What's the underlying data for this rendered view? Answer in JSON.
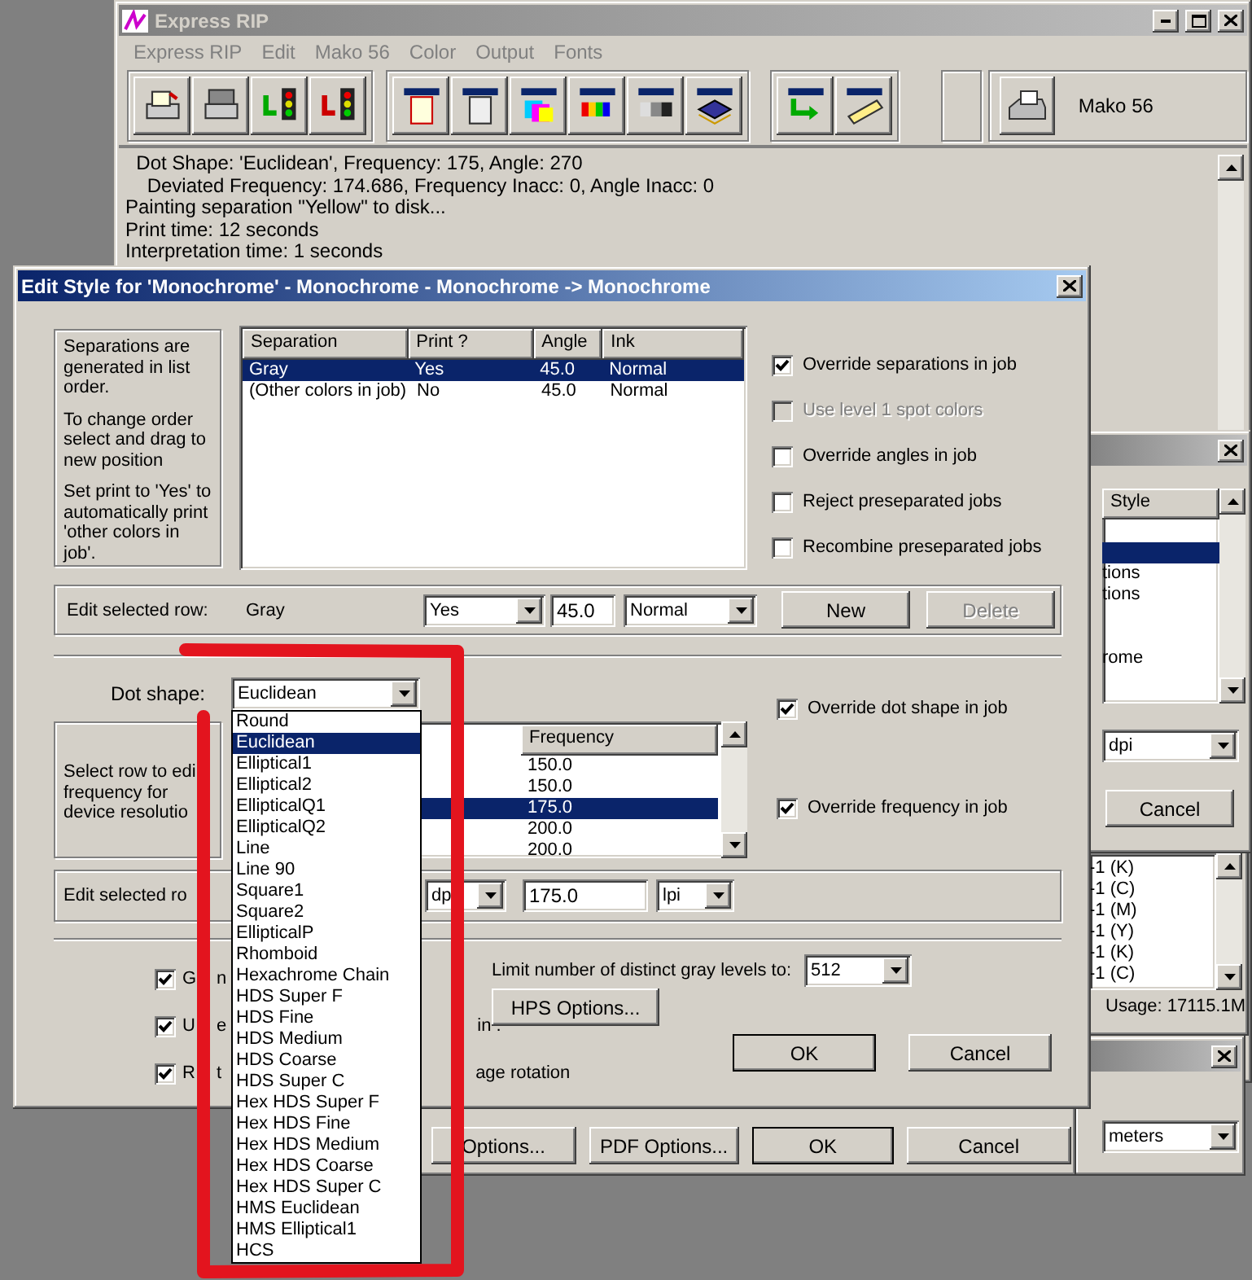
{
  "main_window": {
    "title": "Express RIP",
    "menu": [
      "Express RIP",
      "Edit",
      "Mako 56",
      "Color",
      "Output",
      "Fonts"
    ],
    "device": "Mako 56",
    "log": [
      "  Dot Shape: 'Euclidean', Frequency: 175, Angle: 270",
      "    Deviated Frequency: 174.686, Frequency Inacc: 0, Angle Inacc: 0",
      "Painting separation \"Yellow\" to disk...",
      "Print time: 12 seconds",
      "Interpretation time: 1 seconds"
    ]
  },
  "edit_style": {
    "title": "Edit Style for 'Monochrome' - Monochrome - Monochrome -> Monochrome",
    "help": [
      "Separations are generated in list order.",
      "To change order select and drag to new position",
      "Set print to 'Yes' to automatically print 'other colors in job'."
    ],
    "separations": {
      "columns": [
        "Separation",
        "Print ?",
        "Angle",
        "Ink"
      ],
      "rows": [
        {
          "cells": [
            "Gray",
            "Yes",
            "45.0",
            "Normal"
          ],
          "selected": true
        },
        {
          "cells": [
            "(Other colors in job)",
            "No",
            "45.0",
            "Normal"
          ],
          "selected": false
        }
      ]
    },
    "separation_options": [
      {
        "label": "Override separations in job",
        "checked": true,
        "disabled": false
      },
      {
        "label": "Use level 1 spot colors",
        "checked": false,
        "disabled": true
      },
      {
        "label": "Override angles in job",
        "checked": false,
        "disabled": false
      },
      {
        "label": "Reject preseparated jobs",
        "checked": false,
        "disabled": false
      },
      {
        "label": "Recombine preseparated jobs",
        "checked": false,
        "disabled": false
      }
    ],
    "edit_row": {
      "label": "Edit selected row:",
      "name": "Gray",
      "print": "Yes",
      "angle": "45.0",
      "ink": "Normal",
      "buttons": [
        {
          "label": "New",
          "disabled": false
        },
        {
          "label": "Delete",
          "disabled": true
        }
      ]
    },
    "dot_shape": {
      "label": "Dot shape:",
      "value": "Euclidean",
      "options": [
        {
          "label": "Round",
          "selected": false
        },
        {
          "label": "Euclidean",
          "selected": true
        },
        {
          "label": "Elliptical1",
          "selected": false
        },
        {
          "label": "Elliptical2",
          "selected": false
        },
        {
          "label": "EllipticalQ1",
          "selected": false
        },
        {
          "label": "EllipticalQ2",
          "selected": false
        },
        {
          "label": "Line",
          "selected": false
        },
        {
          "label": "Line 90",
          "selected": false
        },
        {
          "label": "Square1",
          "selected": false
        },
        {
          "label": "Square2",
          "selected": false
        },
        {
          "label": "EllipticalP",
          "selected": false
        },
        {
          "label": "Rhomboid",
          "selected": false
        },
        {
          "label": "Hexachrome Chain",
          "selected": false
        },
        {
          "label": "HDS Super F",
          "selected": false
        },
        {
          "label": "HDS Fine",
          "selected": false
        },
        {
          "label": "HDS Medium",
          "selected": false
        },
        {
          "label": "HDS Coarse",
          "selected": false
        },
        {
          "label": "HDS Super C",
          "selected": false
        },
        {
          "label": "Hex HDS Super F",
          "selected": false
        },
        {
          "label": "Hex HDS Fine",
          "selected": false
        },
        {
          "label": "Hex HDS Medium",
          "selected": false
        },
        {
          "label": "Hex HDS Coarse",
          "selected": false
        },
        {
          "label": "Hex HDS Super C",
          "selected": false
        },
        {
          "label": "HMS Euclidean",
          "selected": false
        },
        {
          "label": "HMS Elliptical1",
          "selected": false
        },
        {
          "label": "HCS",
          "selected": false
        }
      ]
    },
    "screen_options": [
      {
        "label": "Override dot shape in job",
        "checked": true
      },
      {
        "label": "Override frequency in job",
        "checked": true
      }
    ],
    "frequency_help": [
      "Select row to edi",
      "frequency for",
      "device resolutio"
    ],
    "frequency": {
      "column": "Frequency",
      "rows": [
        {
          "value": "150.0",
          "selected": false
        },
        {
          "value": "150.0",
          "selected": false
        },
        {
          "value": "175.0",
          "selected": true
        },
        {
          "value": "200.0",
          "selected": false
        },
        {
          "value": "200.0",
          "selected": false
        }
      ]
    },
    "frequency_edit": {
      "label": "Edit selected ro",
      "resolution_unit": "dp",
      "value": "175.0",
      "unit": "lpi"
    },
    "flags": [
      {
        "label": [
          "G",
          "n"
        ],
        "checked": true
      },
      {
        "label": [
          "U",
          "e"
        ],
        "tail": "in :",
        "checked": true
      },
      {
        "label": [
          "R",
          "t"
        ],
        "tail": "age rotation",
        "checked": true
      }
    ],
    "gray_levels": {
      "label": "Limit number of distinct gray levels to:",
      "value": "512"
    },
    "hps_button": "HPS Options...",
    "buttons": [
      "OK",
      "Cancel"
    ]
  },
  "back_dialog": {
    "buttons": [
      "Options...",
      "PDF Options...",
      "OK",
      "Cancel"
    ]
  },
  "style_window": {
    "column": "Style",
    "rows": [
      "tions",
      "tions",
      "",
      "",
      "rome"
    ],
    "resolution_unit": "dpi",
    "button": "Cancel"
  },
  "job_window": {
    "rows": [
      "-1 (K)",
      "-1 (C)",
      "-1 (M)",
      "-1 (Y)",
      "-1 (K)",
      "-1 (C)"
    ],
    "usage": "Usage: 17115.1M"
  },
  "units_window": {
    "value": "meters"
  }
}
